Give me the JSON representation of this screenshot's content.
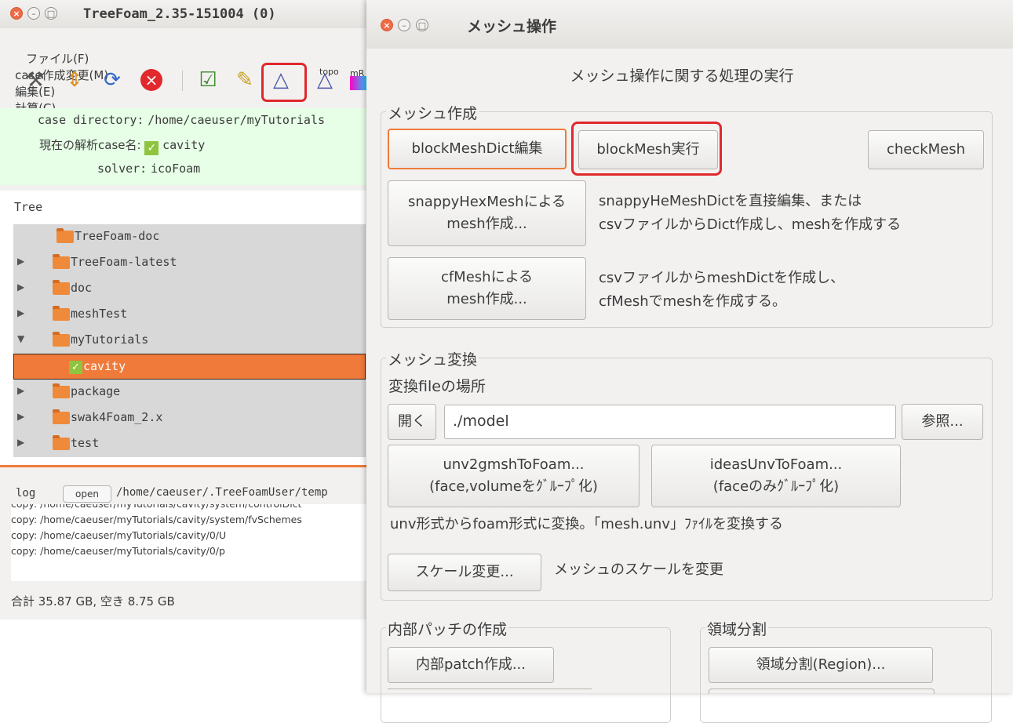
{
  "left_window": {
    "title": "TreeFoam_2.35-151004 (0)",
    "menu": [
      "ファイル(F)",
      "case作成変更(M)",
      "編集(E)",
      "計算(C)"
    ],
    "toolbar": {
      "icons": [
        "tools-icon",
        "up-down-icon",
        "refresh-icon",
        "stop-icon",
        "check-doc-icon",
        "edit-doc-icon",
        "mesh-icon",
        "topo-icon",
        "mesh-grid-icon"
      ],
      "topo_label": "topo",
      "mr_label": "mR"
    },
    "case_info": {
      "dir_label": "case directory:",
      "dir_value": "/home/caeuser/myTutorials",
      "case_label": "現在の解析case名:",
      "case_value": "cavity",
      "solver_label": "solver:",
      "solver_value": "icoFoam"
    },
    "tree": {
      "header": "Tree",
      "rows": [
        {
          "label": "TreeFoam-doc",
          "arrow": ""
        },
        {
          "label": "TreeFoam-latest",
          "arrow": "▶"
        },
        {
          "label": "doc",
          "arrow": "▶"
        },
        {
          "label": "meshTest",
          "arrow": "▶"
        },
        {
          "label": "myTutorials",
          "arrow": "▼"
        },
        {
          "label": "cavity",
          "arrow": ""
        },
        {
          "label": "package",
          "arrow": "▶"
        },
        {
          "label": "swak4Foam_2.x",
          "arrow": "▶"
        },
        {
          "label": "test",
          "arrow": "▶"
        }
      ]
    },
    "log": {
      "label": "log",
      "open_label": "open",
      "path": "/home/caeuser/.TreeFoamUser/temp",
      "lines": [
        "copy: /home/caeuser/myTutorials/cavity/system/controlDict",
        "copy: /home/caeuser/myTutorials/cavity/system/fvSchemes",
        "copy: /home/caeuser/myTutorials/cavity/0/U",
        "copy: /home/caeuser/myTutorials/cavity/0/p"
      ]
    },
    "disk": "合計 35.87 GB,  空き 8.75 GB"
  },
  "right_window": {
    "title": "メッシュ操作",
    "header": "メッシュ操作に関する処理の実行",
    "mesh_create": {
      "label": "メッシュ作成",
      "blockmeshdict_edit": "blockMeshDict編集",
      "blockmesh_run": "blockMesh実行",
      "checkmesh": "checkMesh",
      "snappy_button": "snappyHexMeshによる\nmesh作成...",
      "snappy_desc": "snappyHeMeshDictを直接編集、または\ncsvファイルからDict作成し、meshを作成する",
      "cfmesh_button": "cfMeshによる\nmesh作成...",
      "cfmesh_desc": "csvファイルからmeshDictを作成し、\ncfMeshでmeshを作成する。"
    },
    "mesh_convert": {
      "label": "メッシュ変換",
      "file_location_label": "変換fileの場所",
      "open_button": "開く",
      "path_value": "./model",
      "browse_button": "参照...",
      "unv2gmsh_button": "unv2gmshToFoam...\n(face,volumeをｸﾞﾙｰﾌﾟ化)",
      "ideas_button": "ideasUnvToFoam...\n(faceのみｸﾞﾙｰﾌﾟ化)",
      "desc": "unv形式からfoam形式に変換。「mesh.unv」ﾌｧｲﾙを変換する",
      "scale_button": "スケール変更...",
      "scale_desc": "メッシュのスケールを変更"
    },
    "internal_patch": {
      "label": "内部パッチの作成",
      "button": "内部patch作成..."
    },
    "region_split": {
      "label": "領域分割",
      "button": "領域分割(Region)..."
    }
  },
  "colors": {
    "highlight_red": "#e0282d",
    "accent_orange": "#ef7a3a",
    "info_bg": "#e6ffe6"
  }
}
